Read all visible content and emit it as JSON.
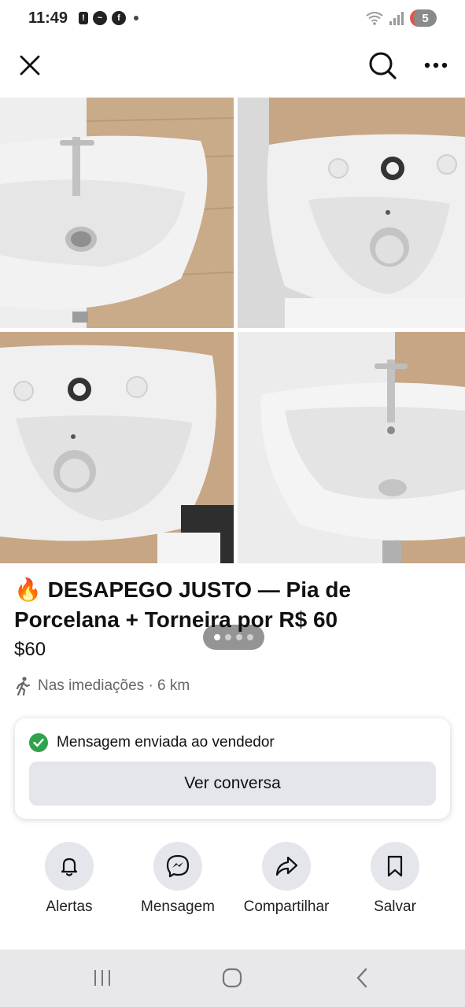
{
  "status_bar": {
    "time": "11:49",
    "battery": "5"
  },
  "top_bar": {
    "close_icon": "close-icon",
    "search_icon": "search-icon",
    "more_icon": "more-horizontal-icon"
  },
  "gallery": {
    "photo_count": 4,
    "active_page": 1,
    "page_dots": 4
  },
  "listing": {
    "emoji": "🔥",
    "title": "DESAPEGO JUSTO — Pia de Porcelana + Torneira por R$ 60",
    "price": "$60",
    "location": "Nas imediações · 6 km"
  },
  "message_card": {
    "status": "Mensagem enviada ao vendedor",
    "view_button": "Ver conversa"
  },
  "actions": [
    {
      "label": "Alertas",
      "icon": "bell-icon"
    },
    {
      "label": "Mensagem",
      "icon": "messenger-icon"
    },
    {
      "label": "Compartilhar",
      "icon": "share-icon"
    },
    {
      "label": "Salvar",
      "icon": "bookmark-icon"
    }
  ],
  "colors": {
    "success": "#31a24c",
    "button_gray": "#e4e6eb",
    "secondary_text": "#65676b"
  }
}
